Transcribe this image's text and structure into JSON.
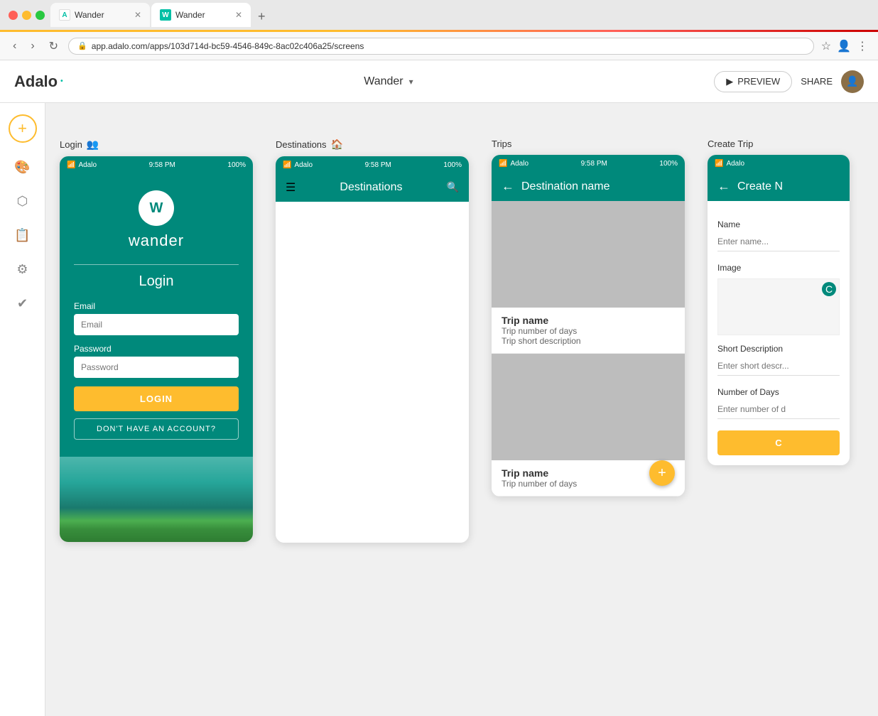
{
  "browser": {
    "tab1": {
      "label": "Wander",
      "favicon": "A",
      "active": false
    },
    "tab2": {
      "label": "Wander",
      "favicon": "W",
      "active": true
    },
    "address": "app.adalo.com/apps/103d714d-bc59-4546-849c-8ac02c406a25/screens"
  },
  "header": {
    "app_name": "Wander",
    "preview_label": "PREVIEW",
    "share_label": "SHARE"
  },
  "screens": {
    "login": {
      "label": "Login",
      "statusbar": {
        "network": "Adalo",
        "time": "9:58 PM",
        "battery": "100%"
      },
      "logo_letter": "W",
      "app_name": "wander",
      "title": "Login",
      "email_label": "Email",
      "email_placeholder": "Email",
      "password_label": "Password",
      "password_placeholder": "Password",
      "login_btn": "LOGIN",
      "no_account_btn": "DON'T HAVE AN ACCOUNT?"
    },
    "destinations": {
      "label": "Destinations",
      "statusbar": {
        "network": "Adalo",
        "time": "9:58 PM",
        "battery": "100%"
      },
      "title": "Destinations"
    },
    "trips": {
      "label": "Trips",
      "statusbar": {
        "network": "Adalo",
        "time": "9:58 PM",
        "battery": "100%"
      },
      "title": "Destination name",
      "cards": [
        {
          "name": "Trip name",
          "days": "Trip number of days",
          "description": "Trip short description"
        },
        {
          "name": "Trip name",
          "days": "Trip number of days",
          "description": ""
        }
      ],
      "fab_label": "+"
    },
    "create_trip": {
      "label": "Create Trip",
      "statusbar": {
        "network": "Adalo",
        "time": "",
        "battery": ""
      },
      "title": "Create N",
      "name_label": "Name",
      "name_placeholder": "Enter name...",
      "image_label": "Image",
      "short_desc_label": "Short Description",
      "short_desc_placeholder": "Enter short descr...",
      "days_label": "Number of Days",
      "days_placeholder": "Enter number of d",
      "submit_label": "C"
    }
  },
  "sidebar": {
    "add_icon": "+",
    "icons": [
      "🎨",
      "⬡",
      "📋",
      "⚙",
      "✔"
    ]
  }
}
